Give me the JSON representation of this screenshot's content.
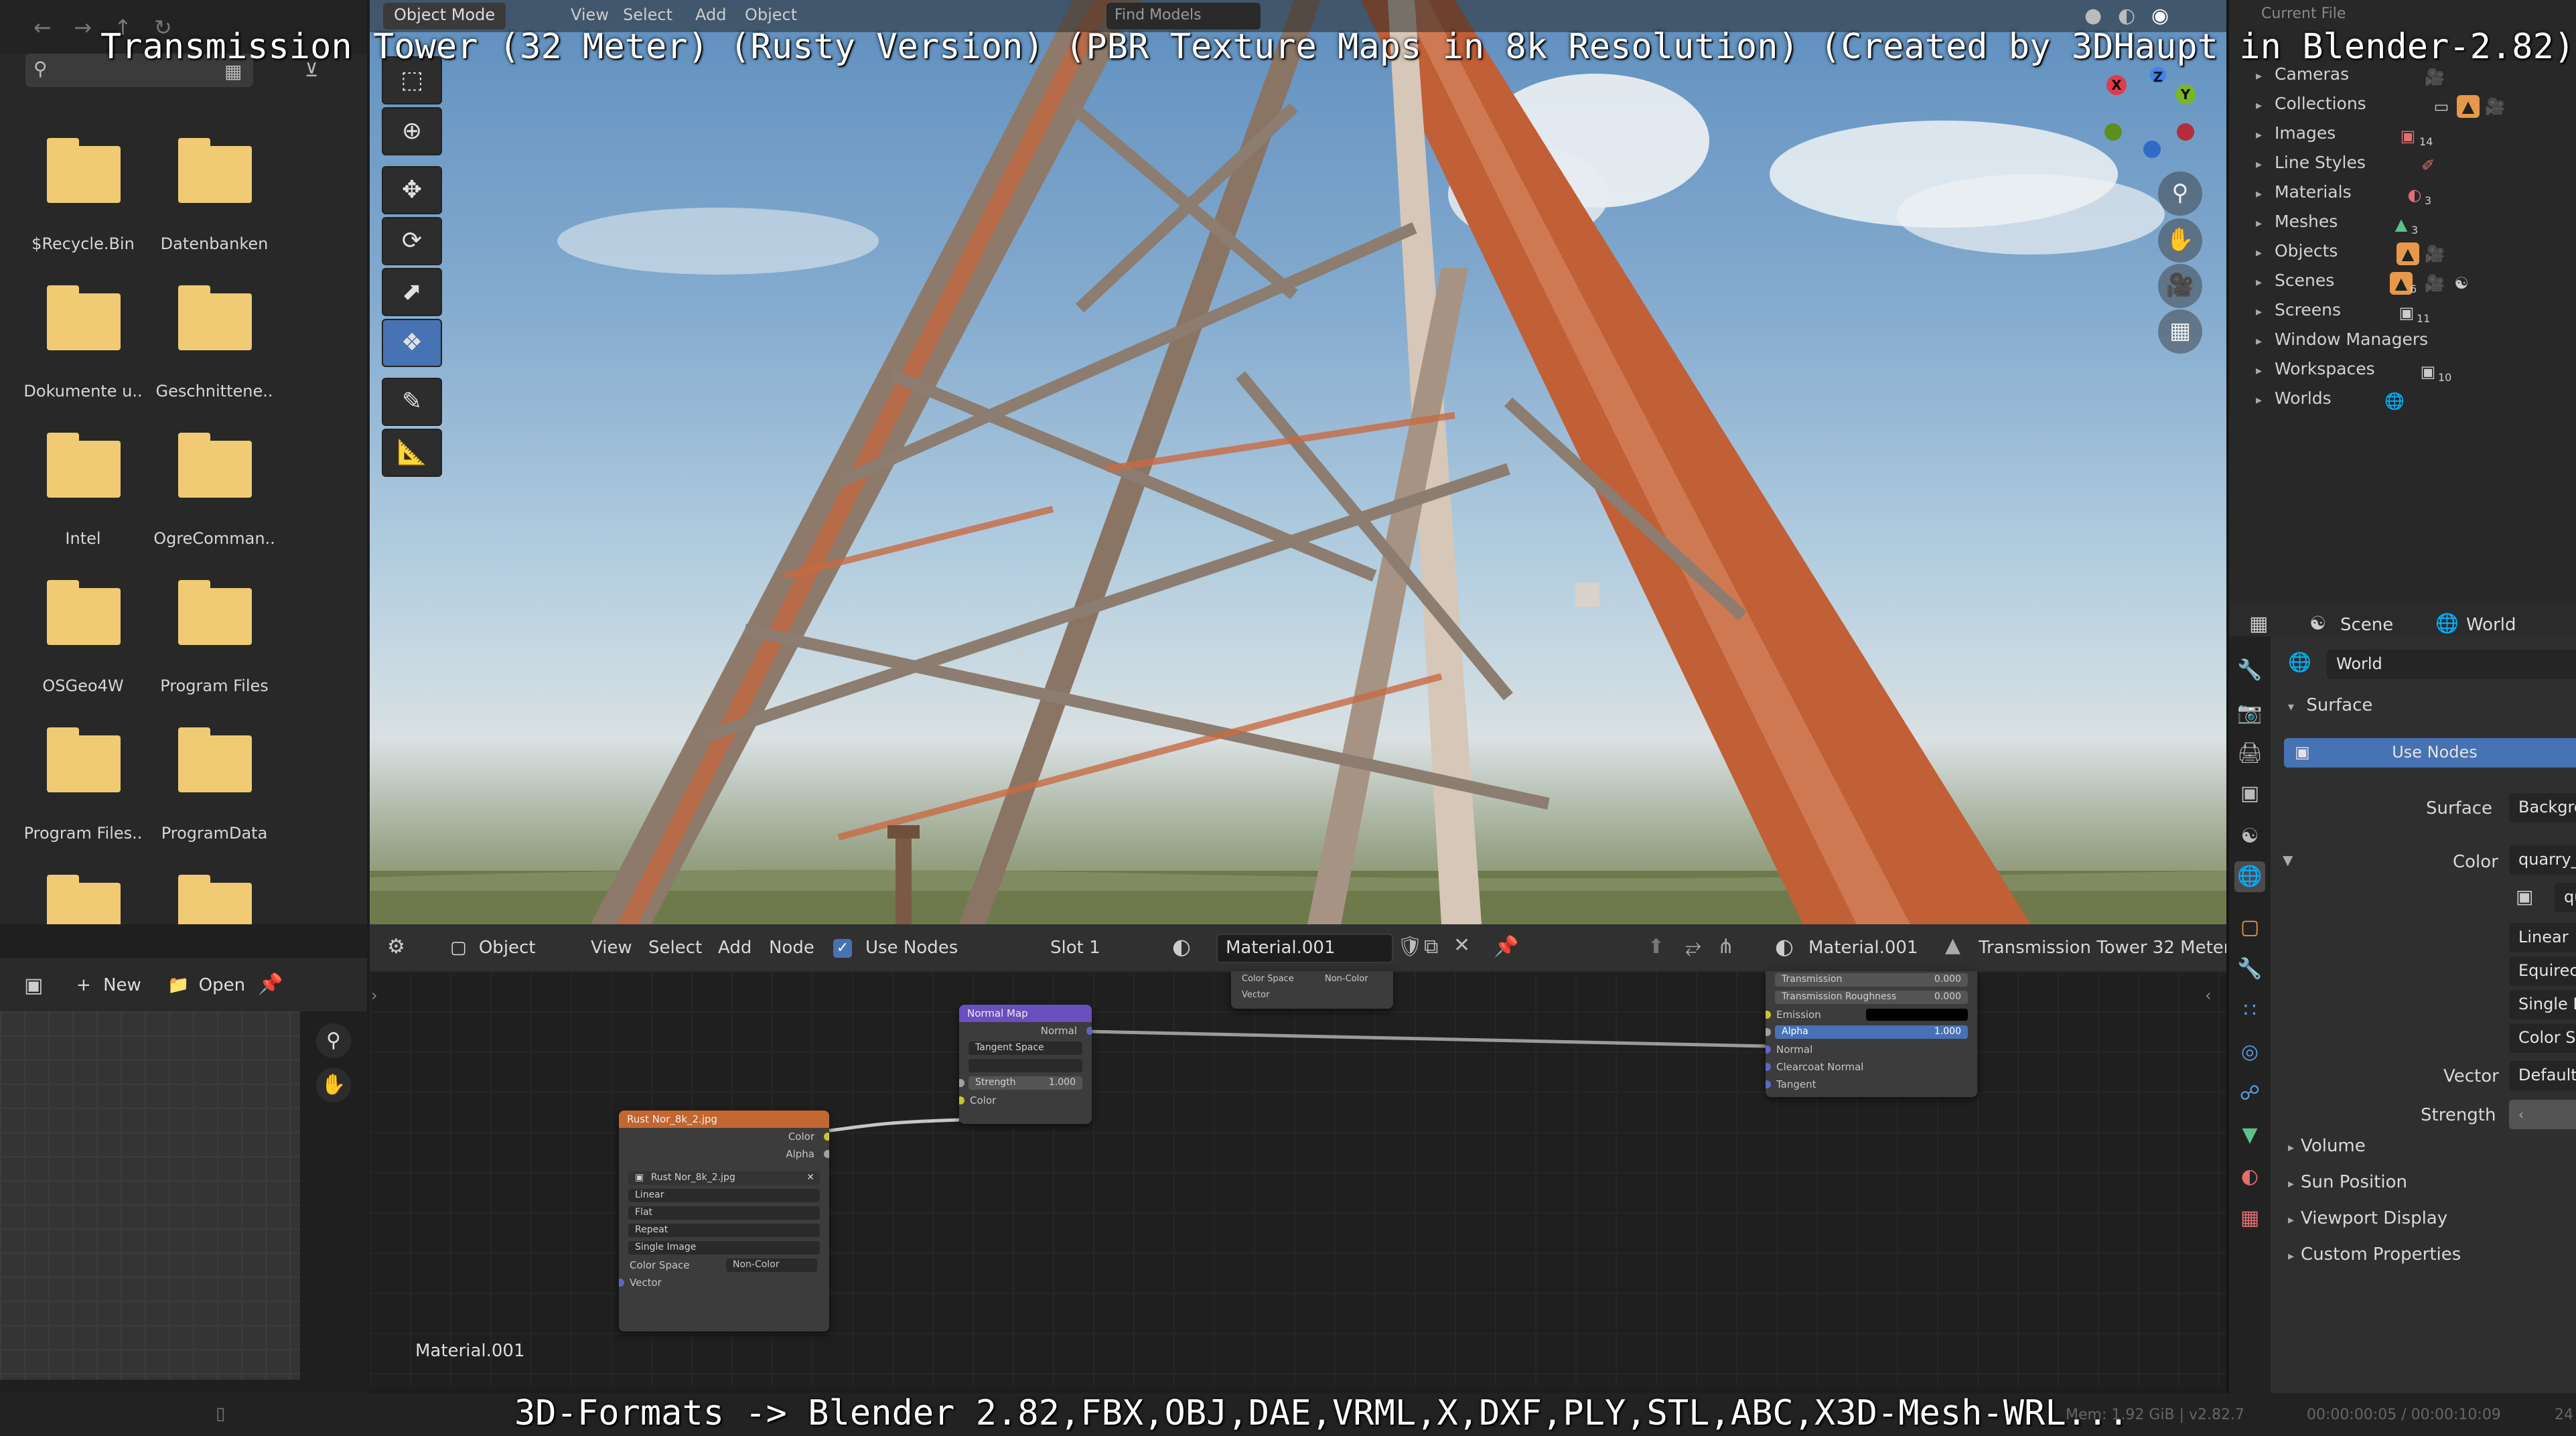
{
  "overlay": {
    "title": "Transmission Tower (32 Meter) (Rusty Version) (PBR Texture Maps in 8k Resolution) (Created by 3DHaupt in Blender-2.82)",
    "footer": "3D-Formats -> Blender 2.82,FBX,OBJ,DAE,VRML,X,DXF,PLY,STL,ABC,X3D-Mesh-WRL..."
  },
  "topbar": {
    "mode": "Object Mode",
    "view": "View",
    "select": "Select",
    "add": "Add",
    "object": "Object",
    "find_models": "Find Models",
    "current_file": "Current File"
  },
  "file_browser": {
    "folders": [
      "$Recycle.Bin",
      "Datenbanken",
      "Dokumente u..",
      "Geschnittene..",
      "Intel",
      "OgreComman..",
      "OSGeo4W",
      "Program Files",
      "Program Files..",
      "ProgramData",
      "",
      ""
    ]
  },
  "image_editor": {
    "new": "New",
    "open": "Open"
  },
  "node_editor": {
    "header": {
      "editor_type": "Object",
      "view": "View",
      "select": "Select",
      "add": "Add",
      "node": "Node",
      "use_nodes": "Use Nodes",
      "slot": "Slot 1",
      "material": "Material.001",
      "material_right": "Material.001",
      "object_name": "Transmission Tower 32 Meter"
    },
    "material_label": "Material.001",
    "image_node": {
      "title": "Rust Nor_8k_2.jpg",
      "out_color": "Color",
      "out_alpha": "Alpha",
      "image_name": "Rust Nor_8k_2.jpg",
      "interpolation": "Linear",
      "projection": "Flat",
      "extension": "Repeat",
      "source": "Single Image",
      "color_space_label": "Color Space",
      "color_space": "Non-Color",
      "in_vector": "Vector"
    },
    "normal_map_node": {
      "title": "Normal Map",
      "out_normal": "Normal",
      "space": "Tangent Space",
      "uv": "",
      "strength_label": "Strength",
      "strength": "1.000",
      "in_color": "Color"
    },
    "top_node": {
      "color_space_label": "Color Space",
      "color_space": "Non-Color",
      "vector": "Vector"
    },
    "bsdf_node": {
      "rows": [
        {
          "label": "Transmission",
          "value": "0.000"
        },
        {
          "label": "Transmission Roughness",
          "value": "0.000"
        },
        {
          "label": "Emission",
          "value": ""
        },
        {
          "label": "Alpha",
          "value": "1.000"
        },
        {
          "label": "Normal",
          "value": ""
        },
        {
          "label": "Clearcoat Normal",
          "value": ""
        },
        {
          "label": "Tangent",
          "value": ""
        }
      ]
    }
  },
  "outliner": {
    "items": [
      {
        "label": "Cameras"
      },
      {
        "label": "Collections"
      },
      {
        "label": "Images"
      },
      {
        "label": "Line Styles"
      },
      {
        "label": "Materials"
      },
      {
        "label": "Meshes"
      },
      {
        "label": "Objects"
      },
      {
        "label": "Scenes"
      },
      {
        "label": "Screens"
      },
      {
        "label": "Window Managers"
      },
      {
        "label": "Workspaces"
      },
      {
        "label": "Worlds"
      }
    ],
    "badges": {
      "images": "14",
      "meshes": "3",
      "scenes": "6",
      "screens": "11",
      "workspaces": "10",
      "materials": "3"
    }
  },
  "properties": {
    "scene": "Scene",
    "world": "World",
    "world_name": "World",
    "surface_panel": "Surface",
    "use_nodes": "Use Nodes",
    "surface_label": "Surface",
    "surface_value": "Backgro",
    "color_label": "Color",
    "color_value": "quarry_",
    "image_name": "qu",
    "interpolation": "Linear",
    "projection": "Equirec",
    "source": "Single I",
    "color_space": "Color Sp",
    "vector_label": "Vector",
    "vector_value": "Default",
    "strength_label": "Strength",
    "strength_value": "",
    "panels": [
      "Volume",
      "Sun Position",
      "Viewport Display",
      "Custom Properties"
    ]
  },
  "status": {
    "mem": "Mem: 1.92 GiB | v2.82.7",
    "time": "00:00:00:05 / 00:00:10:09",
    "frame": "24"
  },
  "colors": {
    "accent": "#4772b3",
    "image_node_header": "#c3662f",
    "vector_node_header": "#6a4fbf",
    "folder": "#f0cb73",
    "axis_x": "#e03b4a",
    "axis_y": "#79b628",
    "axis_z": "#3f84e8"
  }
}
